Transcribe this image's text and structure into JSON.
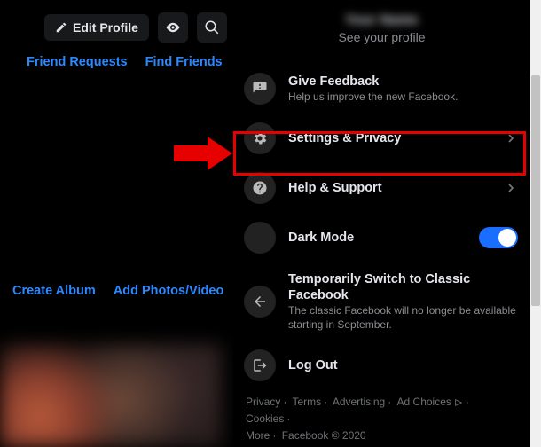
{
  "topbar": {
    "edit_profile": "Edit Profile"
  },
  "links": {
    "friend_requests": "Friend Requests",
    "find_friends": "Find Friends",
    "create_album": "Create Album",
    "add_photos": "Add Photos/Video"
  },
  "profile": {
    "name_hidden": "Your Name",
    "subtitle": "See your profile"
  },
  "menu": {
    "feedback": {
      "title": "Give Feedback",
      "sub": "Help us improve the new Facebook."
    },
    "settings": {
      "title": "Settings & Privacy"
    },
    "help": {
      "title": "Help & Support"
    },
    "dark": {
      "title": "Dark Mode"
    },
    "classic": {
      "title": "Temporarily Switch to Classic Facebook",
      "sub": "The classic Facebook will no longer be available starting in September."
    },
    "logout": {
      "title": "Log Out"
    }
  },
  "footer": {
    "privacy": "Privacy",
    "terms": "Terms",
    "advertising": "Advertising",
    "ad_choices": "Ad Choices",
    "cookies": "Cookies",
    "more": "More",
    "copyright": "Facebook © 2020"
  },
  "colors": {
    "link": "#2d88ff",
    "highlight": "#e60000",
    "toggle_on": "#1a6eff"
  }
}
